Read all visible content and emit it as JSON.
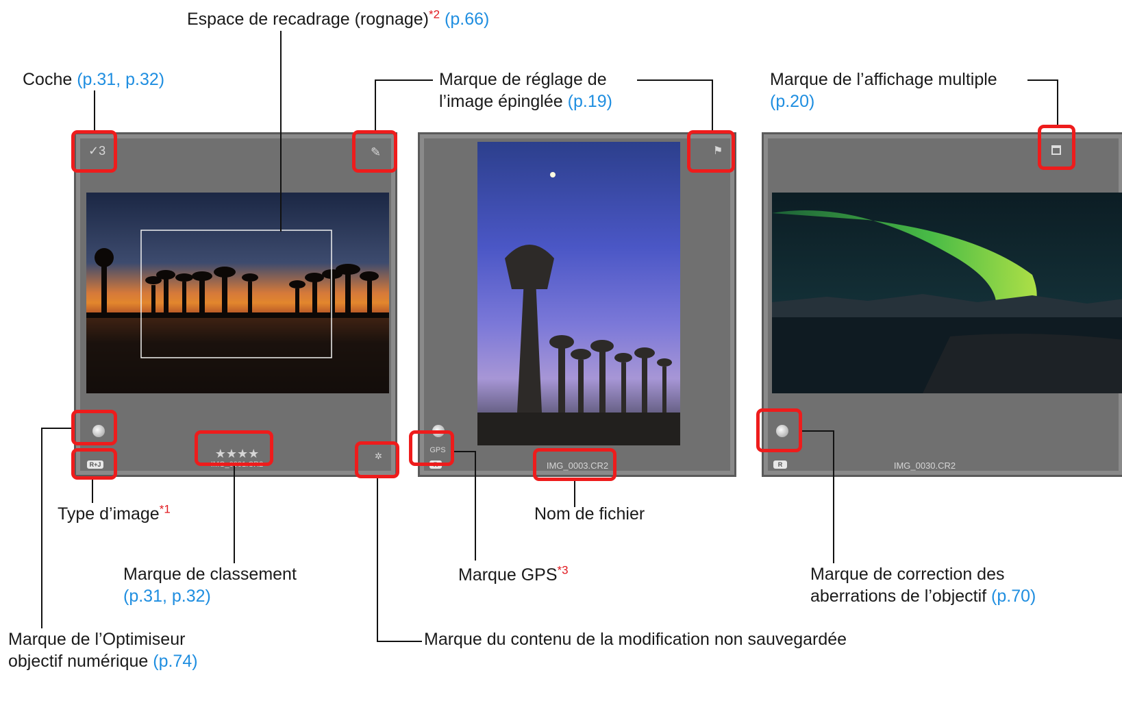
{
  "callouts": {
    "crop": {
      "text": "Espace de recadrage (rognage)",
      "sup": "*2",
      "ref": "(p.66)"
    },
    "check": {
      "text": "Coche",
      "ref": "(p.31, p.32)"
    },
    "pin": {
      "line1": "Marque de réglage de",
      "line2": "l’image épinglée",
      "ref": "(p.19)"
    },
    "multi": {
      "line1": "Marque de l’affichage multiple",
      "ref": "(p.20)"
    },
    "type": {
      "text": "Type d’image",
      "sup": "*1"
    },
    "filename": {
      "text": "Nom de fichier"
    },
    "rating": {
      "line1": "Marque de classement",
      "ref": "(p.31, p.32)"
    },
    "gps": {
      "text": "Marque GPS",
      "sup": "*3"
    },
    "aberr": {
      "line1": "Marque de correction des",
      "line2": "aberrations de l’objectif",
      "ref": "(p.70)"
    },
    "dlo": {
      "line1": "Marque de l’Optimiseur",
      "line2": "objectif numérique",
      "ref": "(p.74)"
    },
    "unsaved": {
      "text": "Marque du contenu de la modification non sauvegardée"
    }
  },
  "thumbnails": [
    {
      "check": "3",
      "stars": "★★★★",
      "file": "IMG_0001.CR2",
      "badge": "R+J",
      "icon": "pin-icon"
    },
    {
      "file": "IMG_0003.CR2",
      "badge": "R",
      "gps": "GPS",
      "icon": "flag-icon"
    },
    {
      "file": "IMG_0030.CR2",
      "badge": "R",
      "icon": "multi-display-icon"
    }
  ],
  "colors": {
    "highlight": "#ee1c1c",
    "link": "#1f8ee0",
    "panel": "#707070"
  }
}
